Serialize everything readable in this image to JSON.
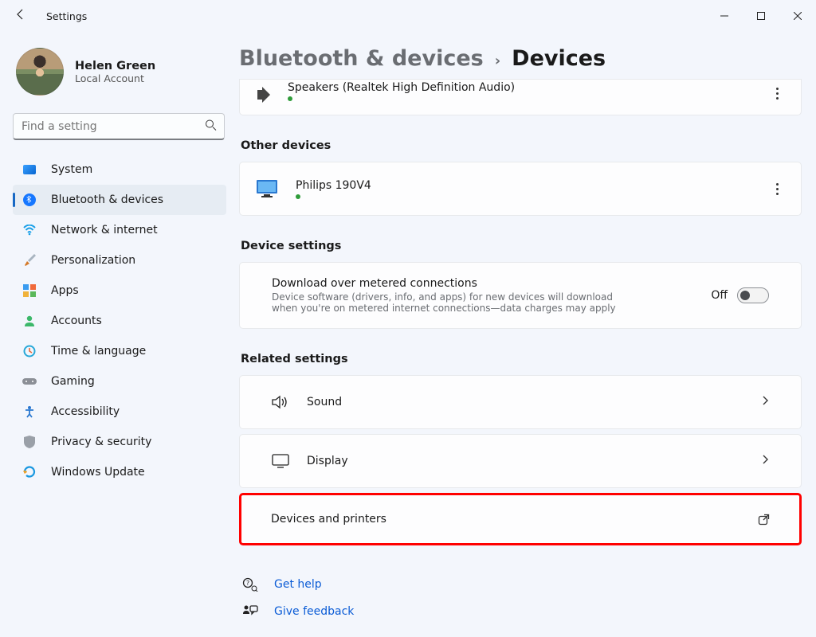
{
  "window": {
    "title": "Settings"
  },
  "user": {
    "name": "Helen Green",
    "account_type": "Local Account"
  },
  "search": {
    "placeholder": "Find a setting"
  },
  "sidebar": {
    "items": [
      {
        "label": "System"
      },
      {
        "label": "Bluetooth & devices"
      },
      {
        "label": "Network & internet"
      },
      {
        "label": "Personalization"
      },
      {
        "label": "Apps"
      },
      {
        "label": "Accounts"
      },
      {
        "label": "Time & language"
      },
      {
        "label": "Gaming"
      },
      {
        "label": "Accessibility"
      },
      {
        "label": "Privacy & security"
      },
      {
        "label": "Windows Update"
      }
    ]
  },
  "breadcrumb": {
    "parent": "Bluetooth & devices",
    "current": "Devices"
  },
  "audio_device": {
    "name": "Speakers (Realtek High Definition Audio)"
  },
  "sections": {
    "other_devices": "Other devices",
    "device_settings": "Device settings",
    "related_settings": "Related settings"
  },
  "other_device": {
    "name": "Philips 190V4"
  },
  "metered": {
    "title": "Download over metered connections",
    "desc": "Device software (drivers, info, and apps) for new devices will download when you're on metered internet connections—data charges may apply",
    "state": "Off"
  },
  "related": {
    "sound": "Sound",
    "display": "Display",
    "devprint": "Devices and printers"
  },
  "help": {
    "get_help": "Get help",
    "feedback": "Give feedback"
  }
}
